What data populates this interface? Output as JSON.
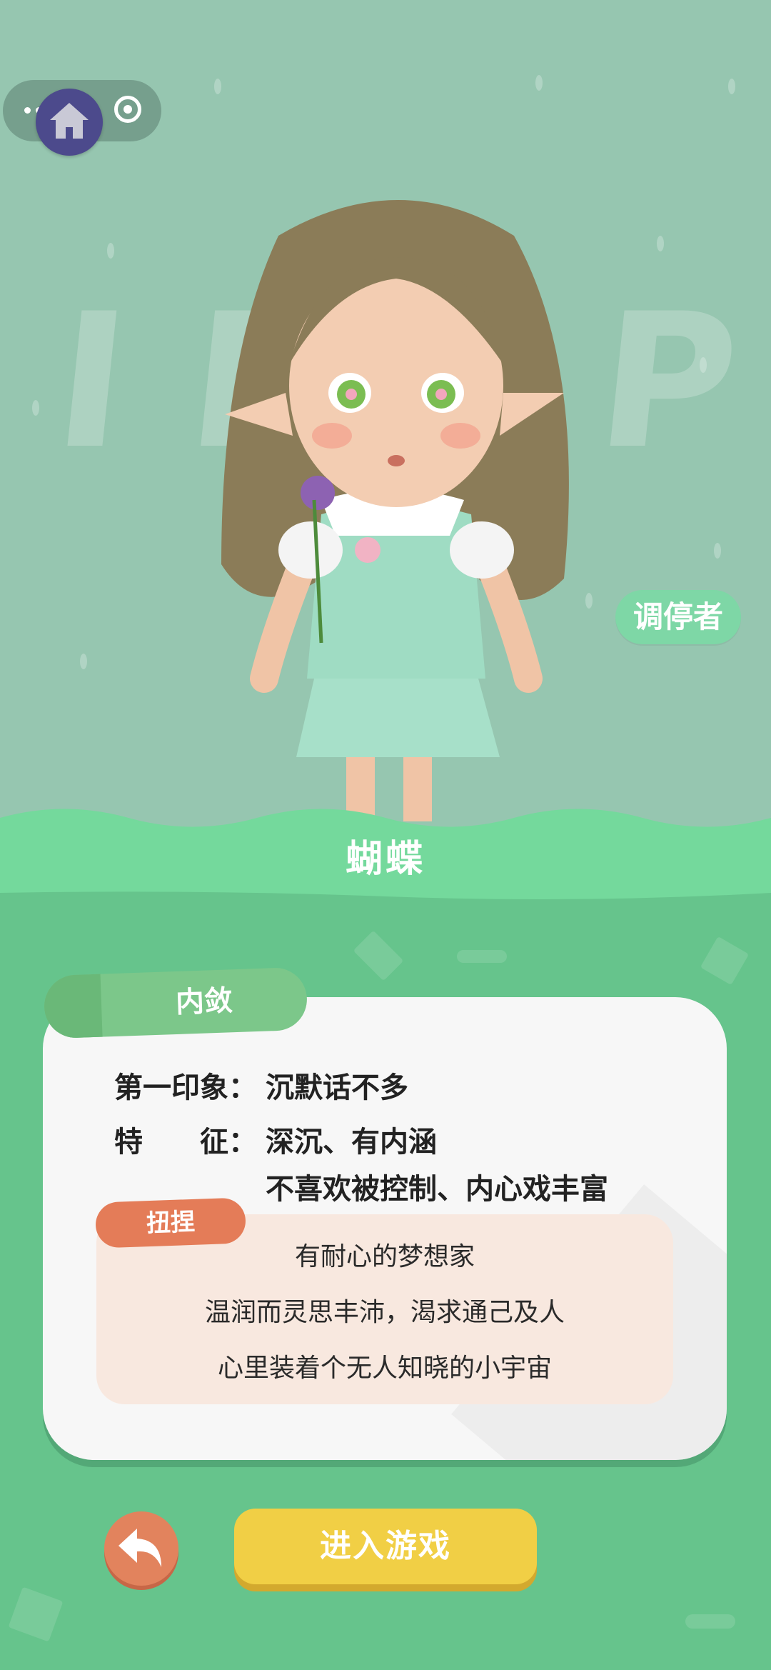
{
  "header": {
    "home_icon": "home-icon",
    "menu_icon": "more-dots-icon",
    "close_icon": "target-circle-icon"
  },
  "background": {
    "letters": "IDEP"
  },
  "character": {
    "role_badge": "调停者",
    "name": "蝴蝶"
  },
  "card": {
    "tab_label": "内敛",
    "first_impression_label": "第一印象：",
    "first_impression_value": "沉默话不多",
    "traits_label": "特　　征：",
    "traits_line1": "深沉、有内涵",
    "traits_line2": "不喜欢被控制、内心戏丰富",
    "quote_tag": "扭捏",
    "quote_lines": [
      "有耐心的梦想家",
      "温润而灵思丰沛，渴求通己及人",
      "心里装着个无人知晓的小宇宙"
    ]
  },
  "actions": {
    "back_icon": "back-arrow-icon",
    "start_label": "进入游戏"
  },
  "colors": {
    "top_bg": "#96c6b0",
    "lower_bg": "#66c48c",
    "wave": "#74d99c",
    "start_button": "#f1cf45",
    "back_button": "#e2835d",
    "quote_tag": "#e47c58"
  }
}
